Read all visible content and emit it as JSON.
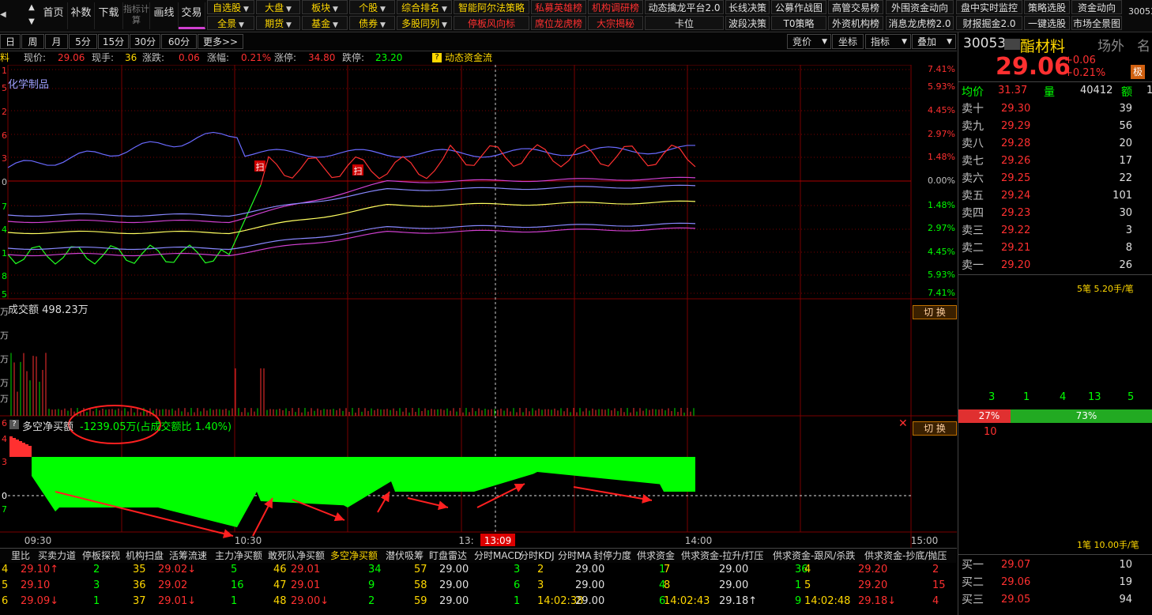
{
  "toolbar": {
    "nav": [
      "首页",
      "补数",
      "下载",
      "指标计算",
      "画线",
      "交易"
    ],
    "row1": [
      {
        "label": "自选股",
        "color": "#ffd800",
        "drop": true
      },
      {
        "label": "大盘",
        "color": "#ffd800",
        "drop": true
      },
      {
        "label": "板块",
        "color": "#ffd800",
        "drop": true
      },
      {
        "label": "个股",
        "color": "#ffd800",
        "drop": true
      },
      {
        "label": "综合排名",
        "color": "#ffd800",
        "drop": true
      },
      {
        "label": "智能阿尔法策略",
        "color": "#ffd800",
        "drop": false
      },
      {
        "label": "私募英雄榜",
        "color": "#ff3030",
        "drop": false
      },
      {
        "label": "机构调研榜",
        "color": "#ff3030",
        "drop": false
      },
      {
        "label": "动态擒龙平台2.0",
        "color": "#e0e0e0",
        "drop": false
      },
      {
        "label": "长线决策",
        "color": "#e0e0e0",
        "drop": false
      },
      {
        "label": "公募作战图",
        "color": "#e0e0e0",
        "drop": false
      },
      {
        "label": "高管交易榜",
        "color": "#e0e0e0",
        "drop": false
      },
      {
        "label": "外围资金动向",
        "color": "#e0e0e0",
        "drop": false
      },
      {
        "label": "盘中实时监控",
        "color": "#e0e0e0",
        "drop": false
      },
      {
        "label": "策略选股",
        "color": "#e0e0e0",
        "drop": false
      },
      {
        "label": "资金动向",
        "color": "#e0e0e0",
        "drop": false
      }
    ],
    "row2": [
      {
        "label": "全景",
        "color": "#ffd800",
        "drop": true
      },
      {
        "label": "期货",
        "color": "#ffd800",
        "drop": true
      },
      {
        "label": "基金",
        "color": "#ffd800",
        "drop": true
      },
      {
        "label": "债券",
        "color": "#ffd800",
        "drop": true
      },
      {
        "label": "多股同列",
        "color": "#ffd800",
        "drop": true
      },
      {
        "label": "停板风向标",
        "color": "#ff3030",
        "drop": false
      },
      {
        "label": "席位龙虎榜",
        "color": "#ff3030",
        "drop": false
      },
      {
        "label": "大宗揭秘",
        "color": "#ff3030",
        "drop": false
      },
      {
        "label": "卡位",
        "color": "#e0e0e0",
        "drop": false
      },
      {
        "label": "波段决策",
        "color": "#e0e0e0",
        "drop": false
      },
      {
        "label": "T0策略",
        "color": "#e0e0e0",
        "drop": false
      },
      {
        "label": "外资机构榜",
        "color": "#e0e0e0",
        "drop": false
      },
      {
        "label": "消息龙虎榜2.0",
        "color": "#e0e0e0",
        "drop": false
      },
      {
        "label": "财报掘金2.0",
        "color": "#e0e0e0",
        "drop": false
      },
      {
        "label": "一键选股",
        "color": "#e0e0e0",
        "drop": false
      },
      {
        "label": "市场全景图",
        "color": "#e0e0e0",
        "drop": false
      }
    ],
    "far_right": "30053"
  },
  "periods": [
    "日",
    "周",
    "月",
    "5分",
    "15分",
    "30分",
    "60分",
    "更多>>"
  ],
  "period_tools": [
    "竞价",
    "坐标",
    "指标",
    "叠加"
  ],
  "info": {
    "name_tail": "料",
    "price_label": "现价:",
    "price": "29.06",
    "hand_label": "现手:",
    "hand": "36",
    "change_label": "涨跌:",
    "change": "0.06",
    "pct_label": "涨幅:",
    "pct": "0.21%",
    "limit_up_label": "涨停:",
    "limit_up": "34.80",
    "limit_down_label": "跌停:",
    "limit_down": "23.20",
    "flow_link": "动态资金流"
  },
  "main_chart": {
    "sector": "化学制品",
    "right_axis": [
      "7.41%",
      "5.93%",
      "4.45%",
      "2.97%",
      "1.48%",
      "0.00%",
      "1.48%",
      "2.97%",
      "4.45%",
      "5.93%",
      "7.41%"
    ],
    "left_axis_partial": [
      "1",
      "5",
      "2",
      "6",
      "3",
      "0",
      "7",
      "4",
      "1",
      "8",
      "5"
    ],
    "scan_marks": [
      "扫",
      "扫"
    ]
  },
  "volume_panel": {
    "label": "成交额",
    "value": "498.23万",
    "switch": "切 换"
  },
  "net_buy_panel": {
    "label": "多空净买额",
    "value": "-1239.05万",
    "ratio": "(占成交额比 1.40%)",
    "switch": "切 换",
    "left_axis_partial": [
      "6",
      "4",
      "3",
      "0",
      "7"
    ]
  },
  "time_axis": [
    "09:30",
    "10:30",
    "13:",
    "13:09",
    "14:00",
    "15:00"
  ],
  "tabs": [
    "里比",
    "买卖力道",
    "停板探视",
    "机构扫盘",
    "活筹流速",
    "主力净买额",
    "敢死队净买额",
    "多空净买额",
    "潜伏吸筹",
    "盯盘雷达",
    "分时MACD",
    "分时KDJ",
    "分时MA",
    "封停力度",
    "供求资金",
    "供求资金-拉升/打压",
    "供求资金-跟风/杀跌",
    "供求资金-抄底/抛压"
  ],
  "bottom_rows": [
    [
      "4",
      "29.10↑",
      "2",
      "35",
      "29.02↓",
      "5",
      "46",
      "29.01",
      "34",
      "57",
      "29.00",
      "3",
      "2",
      "29.00",
      "1",
      "7",
      "29.00",
      "36",
      "4",
      "29.20",
      "2"
    ],
    [
      "5",
      "29.10",
      "3",
      "36",
      "29.02",
      "16",
      "47",
      "29.01",
      "9",
      "58",
      "29.00",
      "6",
      "3",
      "29.00",
      "4",
      "8",
      "29.00",
      "1",
      "5",
      "29.20",
      "15"
    ],
    [
      "6",
      "29.09↓",
      "1",
      "37",
      "29.01↓",
      "1",
      "48",
      "29.00↓",
      "2",
      "59",
      "29.00",
      "1",
      "14:02:38",
      "29.00",
      "6",
      "14:02:43",
      "29.18↑",
      "9",
      "14:02:48",
      "29.18↓",
      "4"
    ]
  ],
  "quote": {
    "code": "30053",
    "name_tail": "酯材料",
    "tag1": "场外",
    "tag2": "名",
    "price": "29.06",
    "change": "+0.06",
    "pct": "+0.21%",
    "badge": "极",
    "avg_label": "均价",
    "avg": "31.37",
    "vol_label": "量",
    "vol": "40412",
    "amt_label": "额",
    "amt": "1",
    "asks": [
      {
        "label": "卖十",
        "price": "29.30",
        "vol": "39"
      },
      {
        "label": "卖九",
        "price": "29.29",
        "vol": "56"
      },
      {
        "label": "卖八",
        "price": "29.28",
        "vol": "20"
      },
      {
        "label": "卖七",
        "price": "29.26",
        "vol": "17"
      },
      {
        "label": "卖六",
        "price": "29.25",
        "vol": "22"
      },
      {
        "label": "卖五",
        "price": "29.24",
        "vol": "101"
      },
      {
        "label": "卖四",
        "price": "29.23",
        "vol": "30"
      },
      {
        "label": "卖三",
        "price": "29.22",
        "vol": "3"
      },
      {
        "label": "卖二",
        "price": "29.21",
        "vol": "8"
      },
      {
        "label": "卖一",
        "price": "29.20",
        "vol": "26"
      }
    ],
    "ask_summary": "5笔 5.20手/笔",
    "dist": [
      "3",
      "1",
      "4",
      "13",
      "5"
    ],
    "bar_left": "27%",
    "bar_right": "73%",
    "bar_left_frac": 0.27,
    "dist_below": "10",
    "bid_summary": "1笔 10.00手/笔",
    "bids": [
      {
        "label": "买一",
        "price": "29.07",
        "vol": "10"
      },
      {
        "label": "买二",
        "price": "29.06",
        "vol": "19"
      },
      {
        "label": "买三",
        "price": "29.05",
        "vol": "94"
      }
    ]
  },
  "colors": {
    "up": "#ff3030",
    "down": "#00ff00",
    "accent": "#ffd800",
    "bg": "#000000"
  }
}
